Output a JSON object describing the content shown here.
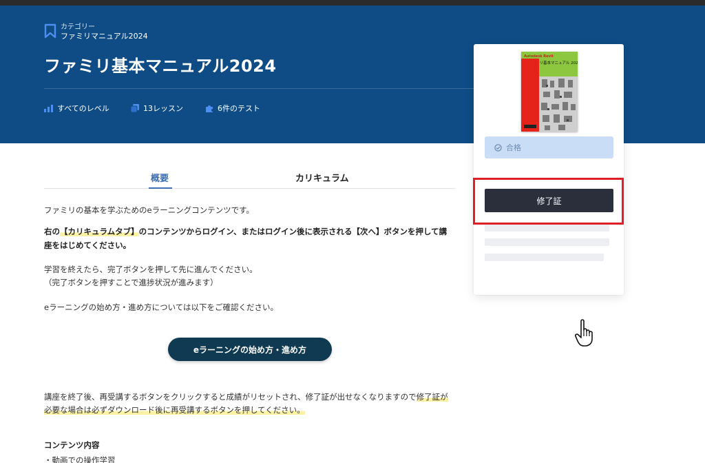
{
  "hero": {
    "category_label": "カテゴリー",
    "category_value": "ファミリマニュアル2024",
    "title": "ファミリ基本マニュアル2024",
    "stats": {
      "level": "すべてのレベル",
      "lessons": "13レッスン",
      "tests": "6件のテスト"
    }
  },
  "tabs": {
    "overview": "概要",
    "curriculum": "カリキュラム"
  },
  "content": {
    "intro": "ファミリの基本を学ぶためのeラーニングコンテンツです。",
    "instr_1": "右の",
    "instr_hl": "【カリキュラムタブ】",
    "instr_2": "のコンテンツからログイン、またはログイン後に表示される【次へ】ボタンを押して講",
    "instr_3": "座をはじめてください。",
    "done_1": "学習を終えたら、完了ボタンを押して先に進んでください。",
    "done_2": "（完了ボタンを押すことで進捗状況が進みます）",
    "howto_text": "eラーニングの始め方・進め方については以下をご確認ください。",
    "howto_button": "eラーニングの始め方・進め方",
    "reset_1": "講座を終了後、再受講するボタンをクリックすると成績がリセットされ、修了証が出せなくなりますので",
    "reset_hl_1": "修了証が",
    "reset_hl_2": "必要な場合は必ずダウンロード後に再受講するボタンを押してください。",
    "contents_heading": "コンテンツ内容",
    "contents_item_1": "・動画での操作学習"
  },
  "sidebar": {
    "cover_brand": "Autodesk Revit",
    "cover_title": "ファミリ基本マニュアル 2024",
    "pass_label": "合格",
    "certificate_button": "修了証"
  },
  "colors": {
    "hero_bg": "#0f4c85",
    "accent": "#3b6fb4",
    "highlight": "#fbf2a6",
    "cta_bg": "#0f3a52",
    "cert_btn_bg": "#2a2f3b",
    "annotation_red": "#e01e25",
    "pass_bg": "#c9ddf7",
    "cover_green": "#8dc63f"
  },
  "icons": {
    "category": "bookmark-icon",
    "level": "bar-chart-icon",
    "lessons": "copy-icon",
    "tests": "puzzle-icon",
    "pass": "check-circle-icon",
    "cursor": "hand-pointer-icon"
  }
}
